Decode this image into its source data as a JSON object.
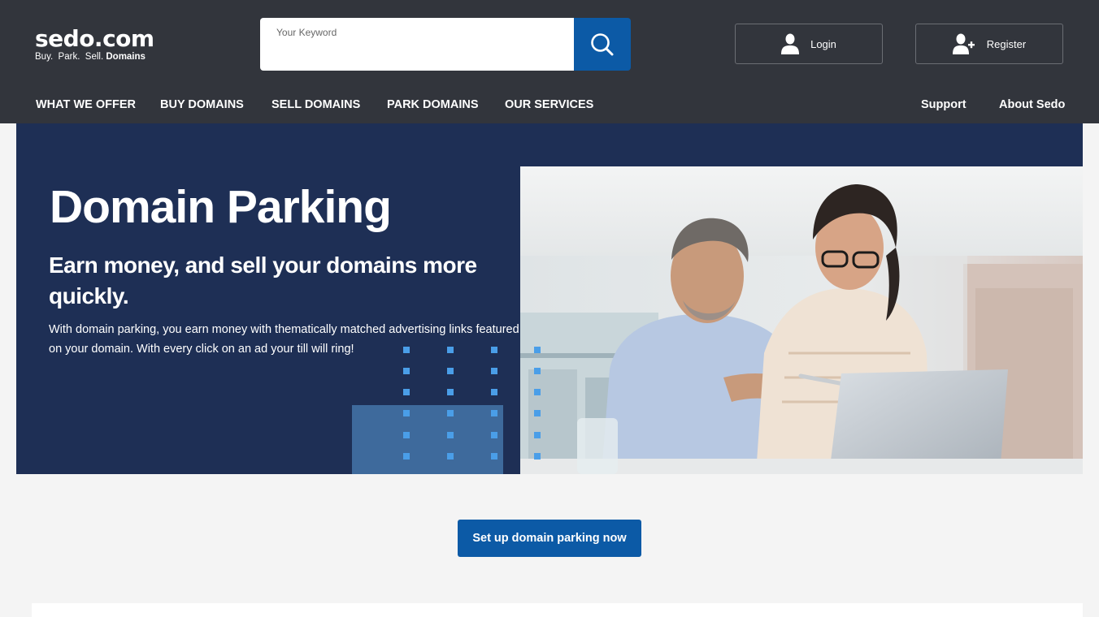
{
  "header": {
    "logo": {
      "main": "sedo.com",
      "tagline_plain": "Buy.  Park.  Sell.",
      "tagline_strong": "Domains"
    },
    "search": {
      "label": "Your Keyword",
      "value": "",
      "placeholder": ""
    },
    "login_label": "Login",
    "register_label": "Register"
  },
  "nav": {
    "items": [
      {
        "label": "WHAT WE OFFER"
      },
      {
        "label": "BUY DOMAINS"
      },
      {
        "label": "SELL DOMAINS"
      },
      {
        "label": "PARK DOMAINS"
      },
      {
        "label": "OUR SERVICES"
      }
    ],
    "right": [
      {
        "label": "Support"
      },
      {
        "label": "About Sedo"
      }
    ]
  },
  "hero": {
    "title": "Domain Parking",
    "subtitle": "Earn money, and sell your domains more quickly.",
    "description": "With domain parking, you earn money with thematically matched advertising links featured on your domain. With every click on an ad your till will ring!"
  },
  "cta": {
    "label": "Set up domain parking now"
  },
  "colors": {
    "header_bg": "#32353c",
    "hero_bg": "#1e2f55",
    "accent_blue": "#0c5aa6",
    "deco_dot": "#4a9ee8",
    "page_bg": "#f4f4f4"
  },
  "icons": {
    "search": "search-icon",
    "login": "user-icon",
    "register": "user-plus-icon"
  }
}
